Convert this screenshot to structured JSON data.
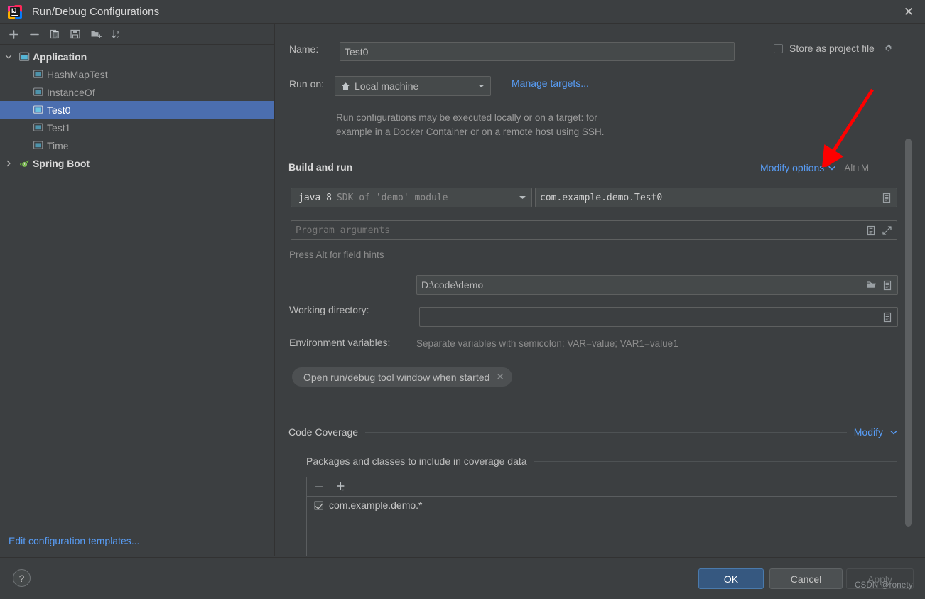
{
  "window": {
    "title": "Run/Debug Configurations",
    "app_icon": "intellij-idea-icon",
    "close_label": "✕"
  },
  "sidebar": {
    "toolbar": [
      {
        "name": "add-configuration-button",
        "icon": "plus-icon",
        "label": "+"
      },
      {
        "name": "remove-configuration-button",
        "icon": "minus-icon",
        "label": "−"
      },
      {
        "name": "copy-configuration-button",
        "icon": "copy-icon",
        "label": "copy"
      },
      {
        "name": "save-configuration-button",
        "icon": "save-icon",
        "label": "save"
      },
      {
        "name": "new-folder-button",
        "icon": "new-folder-icon",
        "label": "new folder"
      },
      {
        "name": "sort-configurations-button",
        "icon": "sort-alpha-icon",
        "label": "sort"
      }
    ],
    "tree": [
      {
        "label": "Application",
        "type": "group",
        "expanded": true,
        "icon": "application-icon"
      },
      {
        "label": "HashMapTest",
        "type": "child",
        "icon": "run-config-icon",
        "selected": false
      },
      {
        "label": "InstanceOf",
        "type": "child",
        "icon": "run-config-icon",
        "selected": false
      },
      {
        "label": "Test0",
        "type": "child",
        "icon": "run-config-icon",
        "selected": true
      },
      {
        "label": "Test1",
        "type": "child",
        "icon": "run-config-icon",
        "selected": false
      },
      {
        "label": "Time",
        "type": "child",
        "icon": "run-config-icon",
        "selected": false
      },
      {
        "label": "Spring Boot",
        "type": "group",
        "expanded": false,
        "icon": "spring-boot-icon"
      }
    ],
    "edit_templates_link": "Edit configuration templates..."
  },
  "form": {
    "name_label": "Name:",
    "name_value": "Test0",
    "store_as_project_file_label": "Store as project file",
    "store_as_project_file_checked": false,
    "store_gear_icon": "gear-icon",
    "run_on_label": "Run on:",
    "run_on_value": "Local machine",
    "run_on_icon": "local-machine-icon",
    "manage_targets_link": "Manage targets...",
    "run_on_help_line1": "Run configurations may be executed locally or on a target: for",
    "run_on_help_line2": "example in a Docker Container or on a remote host using SSH.",
    "build_and_run_title": "Build and run",
    "modify_options_link": "Modify options",
    "modify_options_shortcut": "Alt+M",
    "jdk_value_bold": "java 8",
    "jdk_value_rest": "SDK of 'demo' module",
    "main_class_value": "com.example.demo.Test0",
    "program_arguments_placeholder": "Program arguments",
    "press_alt_hint": "Press Alt for field hints",
    "working_directory_label": "Working directory:",
    "working_directory_value": "D:\\code\\demo",
    "environment_variables_label": "Environment variables:",
    "environment_variables_value": "",
    "env_hint": "Separate variables with semicolon: VAR=value; VAR1=value1",
    "chip_label": "Open run/debug tool window when started",
    "chip_close": "✕",
    "code_coverage_title": "Code Coverage",
    "code_coverage_modify_link": "Modify",
    "coverage_group_title": "Packages and classes to include in coverage data",
    "coverage_remove_icon": "minus-icon",
    "coverage_add_icon": "plus-dropdown-icon",
    "coverage_items": [
      {
        "label": "com.example.demo.*",
        "checked": true
      }
    ],
    "field_icons": {
      "expand": "expand-icon",
      "list": "list-icon",
      "browse": "folder-browse-icon"
    }
  },
  "footer": {
    "help_label": "?",
    "ok_label": "OK",
    "cancel_label": "Cancel",
    "apply_label": "Apply"
  },
  "watermark": "CSDN @ronety",
  "colors": {
    "background": "#3c3f41",
    "field_background": "#45494a",
    "selection": "#4b6eaf",
    "link": "#589df6",
    "ok_button": "#365880",
    "annotation_arrow": "#fe0000"
  }
}
